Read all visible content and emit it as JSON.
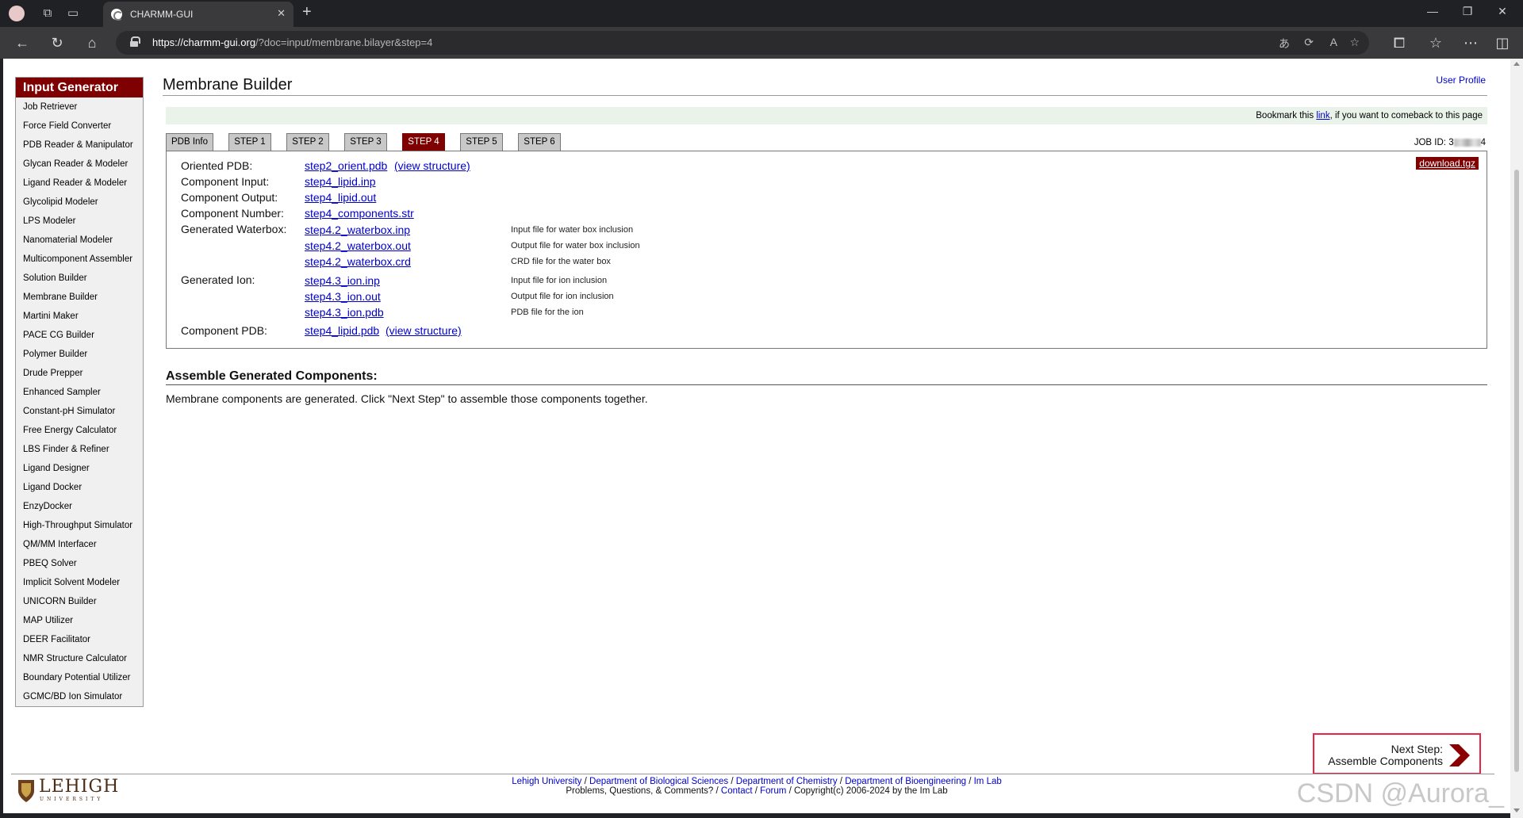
{
  "browser": {
    "tab_title": "CHARMM-GUI",
    "url_domain": "https://charmm-gui.org",
    "url_path": "/?doc=input/membrane.bilayer&step=4"
  },
  "sidebar": {
    "title": "Input Generator",
    "items": [
      "Job Retriever",
      "Force Field Converter",
      "PDB Reader & Manipulator",
      "Glycan Reader & Modeler",
      "Ligand Reader & Modeler",
      "Glycolipid Modeler",
      "LPS Modeler",
      "Nanomaterial Modeler",
      "Multicomponent Assembler",
      "Solution Builder",
      "Membrane Builder",
      "Martini Maker",
      "PACE CG Builder",
      "Polymer Builder",
      "Drude Prepper",
      "Enhanced Sampler",
      "Constant-pH Simulator",
      "Free Energy Calculator",
      "LBS Finder & Refiner",
      "Ligand Designer",
      "Ligand Docker",
      "EnzyDocker",
      "High-Throughput Simulator",
      "QM/MM Interfacer",
      "PBEQ Solver",
      "Implicit Solvent Modeler",
      "UNICORN Builder",
      "MAP Utilizer",
      "DEER Facilitator",
      "NMR Structure Calculator",
      "Boundary Potential Utilizer",
      "GCMC/BD Ion Simulator"
    ]
  },
  "main": {
    "title": "Membrane Builder",
    "user_profile": "User Profile",
    "bookmark_pre": "Bookmark this ",
    "bookmark_link": "link",
    "bookmark_post": ", if you want to comeback to this page",
    "job_id_label": "JOB ID: ",
    "job_id_start": "3",
    "job_id_end": "4",
    "tabs": [
      "PDB Info",
      "STEP 1",
      "STEP 2",
      "STEP 3",
      "STEP 4",
      "STEP 5",
      "STEP 6"
    ],
    "active_tab": "STEP 4",
    "download": "download.tgz"
  },
  "files": {
    "oriented_label": "Oriented PDB:",
    "oriented_file": "step2_orient.pdb",
    "view_structure": "(view structure)",
    "input_label": "Component Input:",
    "input_file": "step4_lipid.inp",
    "output_label": "Component Output:",
    "output_file": "step4_lipid.out",
    "number_label": "Component Number:",
    "number_file": "step4_components.str",
    "waterbox_label": "Generated Waterbox:",
    "waterbox": [
      {
        "file": "step4.2_waterbox.inp",
        "desc": "Input file for water box inclusion"
      },
      {
        "file": "step4.2_waterbox.out",
        "desc": "Output file for water box inclusion"
      },
      {
        "file": "step4.2_waterbox.crd",
        "desc": "CRD file for the water box"
      }
    ],
    "ion_label": "Generated Ion:",
    "ion": [
      {
        "file": "step4.3_ion.inp",
        "desc": "Input file for ion inclusion"
      },
      {
        "file": "step4.3_ion.out",
        "desc": "Output file for ion inclusion"
      },
      {
        "file": "step4.3_ion.pdb",
        "desc": "PDB file for the ion"
      }
    ],
    "pdb_label": "Component PDB:",
    "pdb_file": "step4_lipid.pdb"
  },
  "assemble": {
    "title": "Assemble Generated Components:",
    "text": "Membrane components are generated. Click \"Next Step\" to assemble those components together."
  },
  "next_step": {
    "line1": "Next Step:",
    "line2": "Assemble Components"
  },
  "footer": {
    "logo_name": "LEHIGH",
    "logo_sub": "UNIVERSITY",
    "links": [
      "Lehigh University",
      "Department of Biological Sciences",
      "Department of Chemistry",
      "Department of Bioengineering",
      "Im Lab"
    ],
    "line2_pre": "Problems, Questions, & Comments? / ",
    "contact": "Contact",
    "forum": "Forum",
    "copyright": " / Copyright(c) 2006-2024 by the Im Lab"
  },
  "watermark": "CSDN @Aurora_",
  "colors": {
    "accent": "#7f0000",
    "link": "#0000cc",
    "highlight": "#e22244"
  }
}
